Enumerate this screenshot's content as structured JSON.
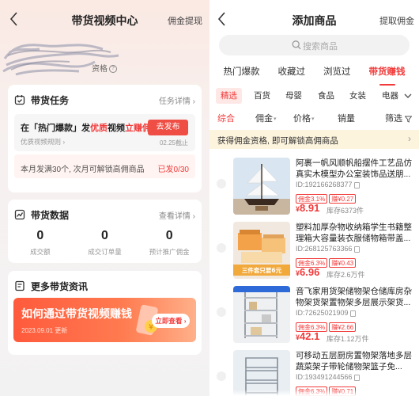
{
  "left": {
    "nav": {
      "title": "带货视频中心",
      "right_link": "佣金提现"
    },
    "user": {
      "qualification": "资格"
    },
    "task_card": {
      "title": "带货任务",
      "more": "任务详情",
      "task": {
        "prefix": "在「热门爆款」发",
        "highlight": "优质",
        "middle": "视频",
        "suffix_highlight": "立赚佣金"
      },
      "rule": "优质视频规则",
      "button": "去发布",
      "deadline": "02.25截止",
      "note": "本月发满30个, 次月可解锁高佣商品",
      "progress": "已发0/30"
    },
    "data_card": {
      "title": "带货数据",
      "more": "查看详情",
      "stats": [
        {
          "value": "0",
          "label": "成交额"
        },
        {
          "value": "0",
          "label": "成交订单量"
        },
        {
          "value": "0",
          "label": "预计推广佣金"
        }
      ]
    },
    "info_card": {
      "title": "更多带货资讯",
      "banner": {
        "title": "如何通过带货视频赚钱",
        "date": "2023.09.01 更新",
        "button": "立即查看"
      }
    }
  },
  "right": {
    "nav": {
      "title": "添加商品",
      "right_link": "提取佣金"
    },
    "search": {
      "placeholder": "搜索商品"
    },
    "tabs": [
      "热门爆款",
      "收藏过",
      "浏览过",
      "带货赚钱"
    ],
    "active_tab": 3,
    "categories": [
      "精选",
      "百货",
      "母婴",
      "食品",
      "女装",
      "电器"
    ],
    "sorts": {
      "comprehensive": "综合",
      "commission": "佣金",
      "price": "价格",
      "sales": "销量",
      "filter": "筛选"
    },
    "notice": "获得佣金资格, 即可解锁高佣商品",
    "products": [
      {
        "title": "阿裹一帆风顺帆船摆件工艺品仿真实木模型办公室装饰品送朋...",
        "id": "ID:192166268377",
        "commission_rate": "佣金3.1%",
        "earn": "赚¥0.27",
        "price": "8.91",
        "stock": "库存6373件"
      },
      {
        "title": "塑料加厚杂物收纳箱学生书籍整理箱大容量装衣服储物箱带盖...",
        "id": "ID:268125763366",
        "commission_rate": "佣金6.3%",
        "earn": "赚¥0.43",
        "price": "6.96",
        "stock": "库存2.6万件",
        "thumb_label": "三件套只要6元"
      },
      {
        "title": "音飞家用货架储物架仓储库房杂物架货架置物架多层展示架货...",
        "id": "ID:72625021909",
        "commission_rate": "佣金6.3%",
        "earn": "赚¥2.66",
        "price": "42.1",
        "stock": "库存1.12万件"
      },
      {
        "title": "可移动五层厨房置物架落地多层蔬菜架子带轮储物架篮子免...",
        "id": "ID:193491244566",
        "commission_rate": "佣金6.3%",
        "earn": "赚¥0.71",
        "price": "",
        "stock": ""
      }
    ],
    "colors": {
      "accent": "#f23a3a",
      "notice_bg": "#fdf4de"
    }
  }
}
